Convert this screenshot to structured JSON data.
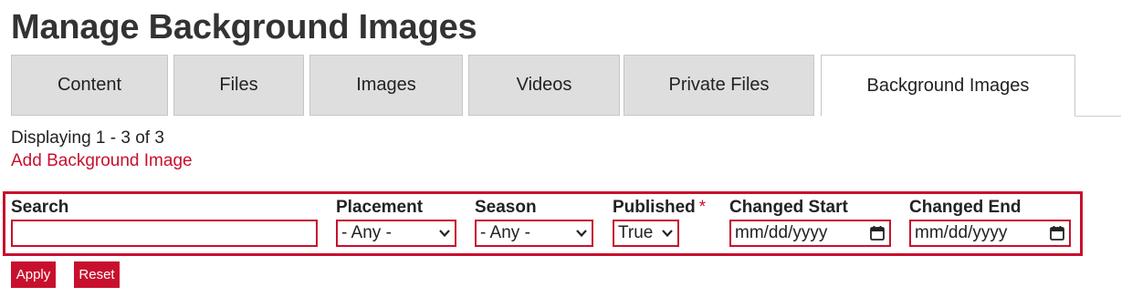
{
  "page": {
    "title": "Manage Background Images"
  },
  "tabs": [
    {
      "label": "Content"
    },
    {
      "label": "Files"
    },
    {
      "label": "Images"
    },
    {
      "label": "Videos"
    },
    {
      "label": "Private Files"
    },
    {
      "label": "Background Images"
    }
  ],
  "active_tab": "Background Images",
  "summary": {
    "displaying": "Displaying 1 - 3 of 3",
    "add_link": "Add Background Image"
  },
  "filters": {
    "search": {
      "label": "Search",
      "value": ""
    },
    "placement": {
      "label": "Placement",
      "value": "- Any -"
    },
    "season": {
      "label": "Season",
      "value": "- Any -"
    },
    "published": {
      "label": "Published",
      "required_mark": "*",
      "value": "True"
    },
    "changed_start": {
      "label": "Changed Start",
      "value": "mm/dd/yyyy"
    },
    "changed_end": {
      "label": "Changed End",
      "value": "mm/dd/yyyy"
    }
  },
  "buttons": {
    "apply": "Apply",
    "reset": "Reset"
  },
  "colors": {
    "accent": "#c8102e",
    "tab_bg": "#dedede",
    "title": "#333333"
  },
  "icons": {
    "select_arrow": "chevron-down-icon",
    "date_picker": "calendar-icon"
  }
}
